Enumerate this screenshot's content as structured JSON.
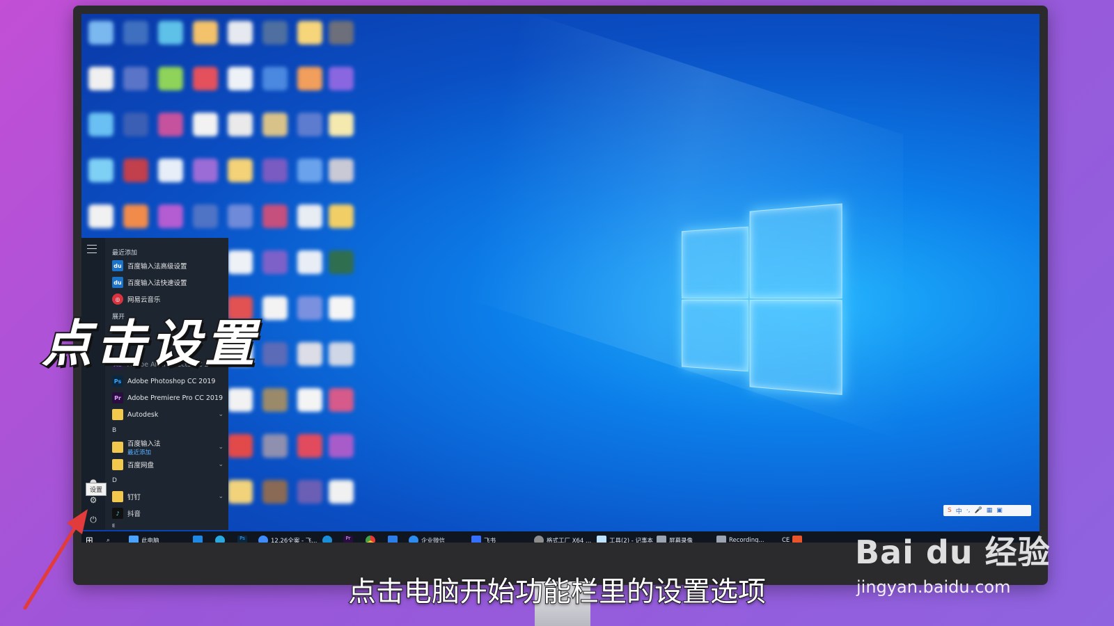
{
  "overlay": {
    "headline": "点击设置",
    "caption": "点击电脑开始功能栏里的设置选项"
  },
  "watermark": {
    "logo": "Bai du 经验",
    "url": "jingyan.baidu.com"
  },
  "start_menu": {
    "recent_header": "最近添加",
    "recent_items": [
      {
        "label": "百度输入法高级设置",
        "icon": "du"
      },
      {
        "label": "百度输入法快速设置",
        "icon": "du"
      },
      {
        "label": "网易云音乐",
        "icon": "netease-music"
      }
    ],
    "expand_label": "展开",
    "apps": [
      {
        "label": "Adobe After Effects CC 2019",
        "icon": "Ae"
      },
      {
        "label": "Adobe Photoshop CC 2019",
        "icon": "Ps"
      },
      {
        "label": "Adobe Premiere Pro CC 2019",
        "icon": "Pr"
      },
      {
        "label": "Autodesk",
        "icon": "folder",
        "expandable": true
      }
    ],
    "group_b": "B",
    "b_apps": [
      {
        "label": "百度输入法",
        "sublabel": "最近添加",
        "icon": "folder",
        "expandable": true
      },
      {
        "label": "百度网盘",
        "icon": "folder",
        "expandable": true
      }
    ],
    "group_d": "D",
    "d_apps": [
      {
        "label": "钉钉",
        "icon": "folder",
        "expandable": true
      },
      {
        "label": "抖音",
        "icon": "douyin"
      }
    ],
    "group_e": "E",
    "settings_tooltip": "设置"
  },
  "taskbar": {
    "items": [
      {
        "label": "此电脑"
      },
      {
        "label": "12.26全案 - 飞..."
      },
      {
        "label": "企业微信"
      },
      {
        "label": "飞书"
      },
      {
        "label": "格式工厂 X64 ..."
      },
      {
        "label": "工具(2) - 记事本"
      },
      {
        "label": "屏幕录像"
      },
      {
        "label": "Recording..."
      },
      {
        "label": "CE"
      }
    ],
    "ime_label": "中"
  },
  "colors": {
    "desktop_blue": "#0c7ee9",
    "start_menu_bg": "#1d2530",
    "taskbar_bg": "#10161f",
    "background_purple": "#b053d6",
    "annotation_arrow": "#e23b3b"
  }
}
